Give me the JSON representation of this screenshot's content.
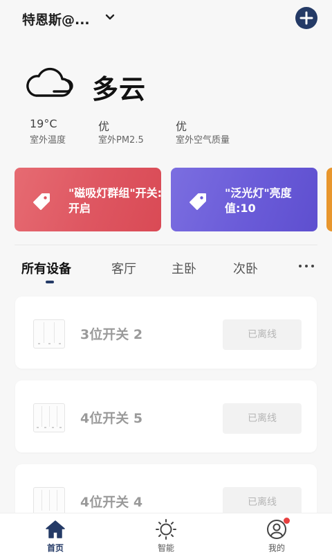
{
  "header": {
    "home_name": "特恩斯@...",
    "chevron_icon": "chevron-down-icon",
    "add_icon": "plus-icon"
  },
  "weather": {
    "icon": "cloudy-icon",
    "text": "多云",
    "metrics": [
      {
        "value": "19°C",
        "label": "室外温度"
      },
      {
        "value": "优",
        "label": "室外PM2.5"
      },
      {
        "value": "优",
        "label": "室外空气质量"
      }
    ]
  },
  "scenes": [
    {
      "text": "\"磁吸灯群组\"开关:开启",
      "icon": "tag-icon",
      "color": "#de5661"
    },
    {
      "text": "\"泛光灯\"亮度值:10",
      "icon": "tag-icon",
      "color": "#6a5bd8"
    },
    {
      "text": "",
      "icon": "",
      "color": "#e8962d"
    }
  ],
  "tabs": [
    {
      "label": "所有设备",
      "active": true
    },
    {
      "label": "客厅",
      "active": false
    },
    {
      "label": "主卧",
      "active": false
    },
    {
      "label": "次卧",
      "active": false
    }
  ],
  "more_icon": "more-horizontal-icon",
  "devices": [
    {
      "name": "3位开关 2",
      "status": "已离线",
      "gangs": 3
    },
    {
      "name": "4位开关 5",
      "status": "已离线",
      "gangs": 4
    },
    {
      "name": "4位开关 4",
      "status": "已离线",
      "gangs": 4
    }
  ],
  "bottom_nav": [
    {
      "label": "首页",
      "icon": "home-icon",
      "active": true
    },
    {
      "label": "智能",
      "icon": "sun-icon",
      "active": false
    },
    {
      "label": "我的",
      "icon": "user-icon",
      "active": false,
      "badge": true
    }
  ],
  "colors": {
    "accent": "#243a66",
    "badge": "#e74040"
  }
}
